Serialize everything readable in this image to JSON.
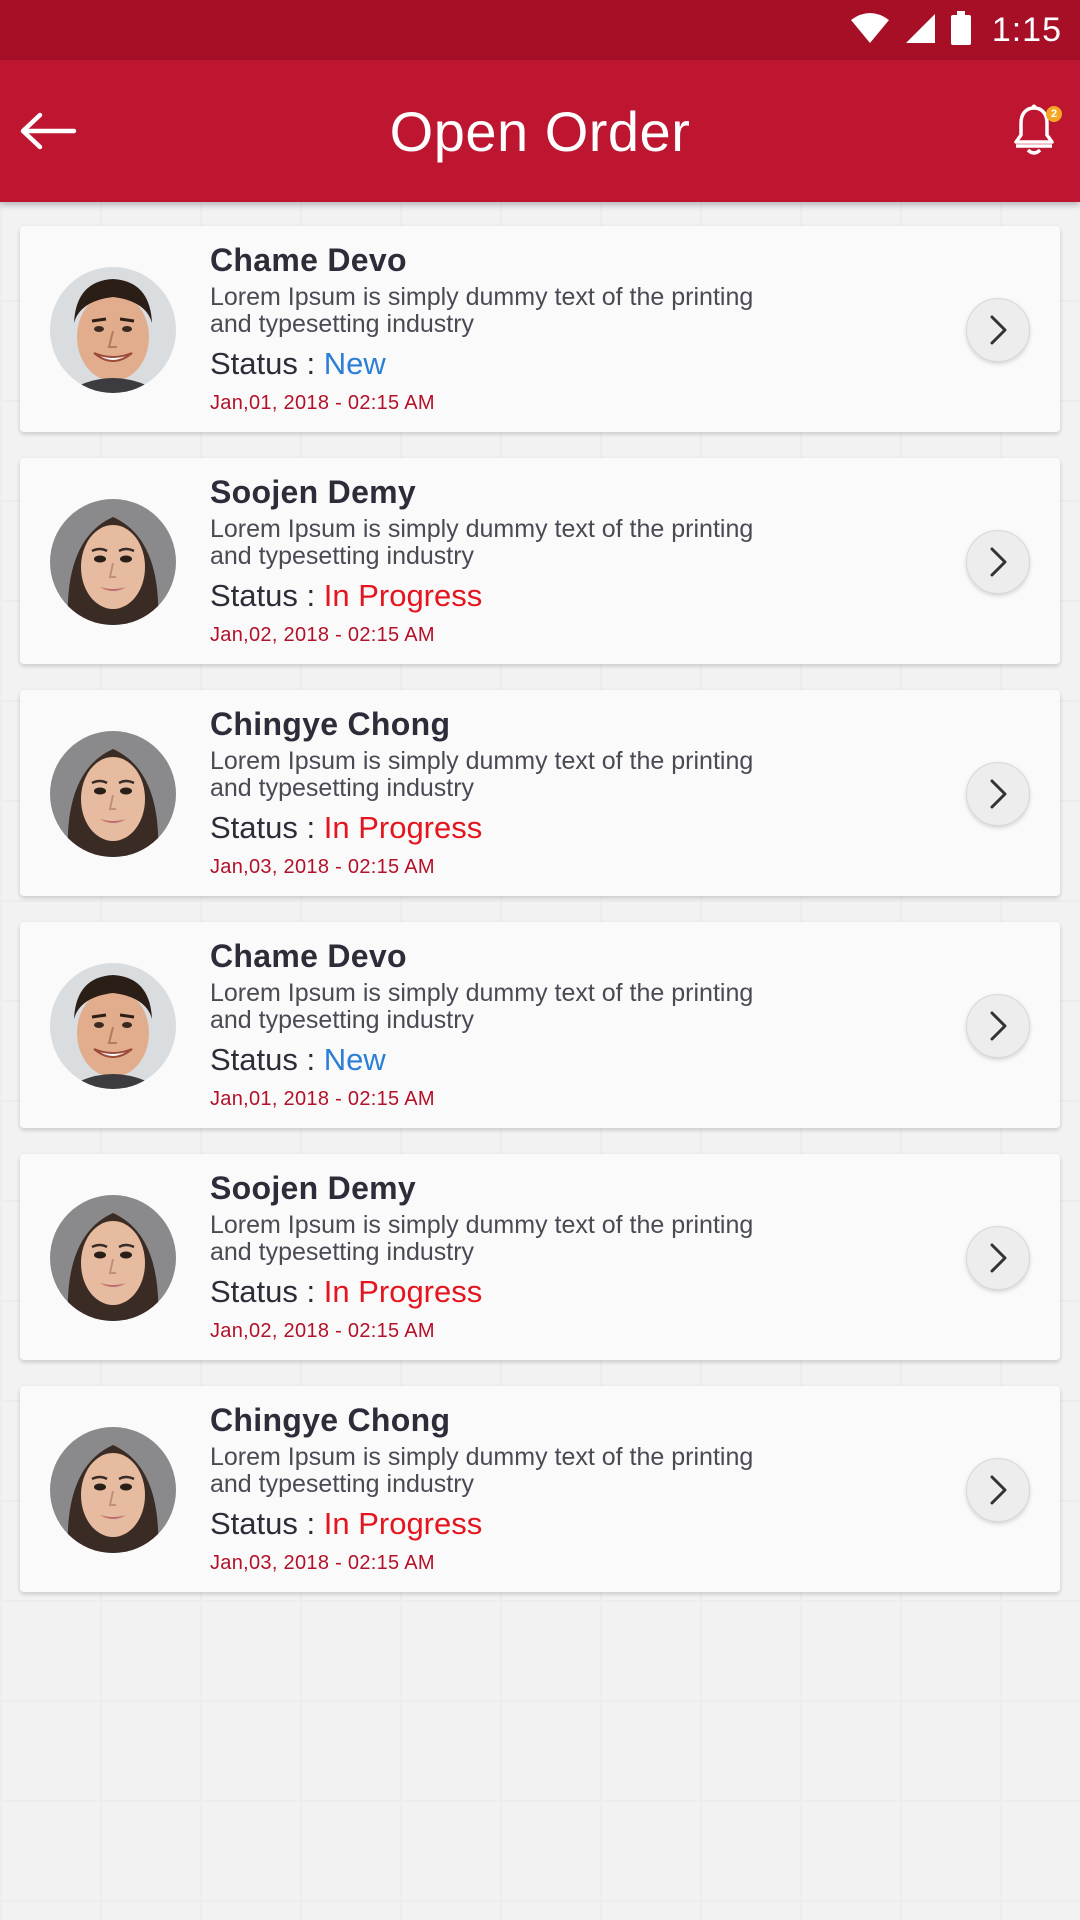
{
  "status_bar": {
    "time": "1:15"
  },
  "header": {
    "title": "Open Order",
    "notification_count": "2"
  },
  "status_prefix": "Status : ",
  "colors": {
    "primary": "#be1530",
    "status_bar": "#a70f27",
    "new": "#2c7fd8",
    "in_progress": "#e4151f",
    "date": "#b3102a"
  },
  "orders": [
    {
      "name": "Chame Devo",
      "desc_line1": "Lorem Ipsum is simply dummy text of the printing",
      "desc_line2": "and typesetting industry",
      "status": "New",
      "date": "Jan,01, 2018 - 02:15 AM",
      "avatar": "male-avatar"
    },
    {
      "name": "Soojen Demy",
      "desc_line1": "Lorem Ipsum is simply dummy text of the printing",
      "desc_line2": "and typesetting industry",
      "status": "In Progress",
      "date": "Jan,02, 2018 - 02:15 AM",
      "avatar": "female-avatar"
    },
    {
      "name": "Chingye Chong",
      "desc_line1": "Lorem Ipsum is simply dummy text of the printing",
      "desc_line2": "and typesetting industry",
      "status": "In Progress",
      "date": "Jan,03, 2018 - 02:15 AM",
      "avatar": "female-avatar"
    },
    {
      "name": "Chame Devo",
      "desc_line1": "Lorem Ipsum is simply dummy text of the printing",
      "desc_line2": "and typesetting industry",
      "status": "New",
      "date": "Jan,01, 2018 - 02:15 AM",
      "avatar": "male-avatar"
    },
    {
      "name": "Soojen Demy",
      "desc_line1": "Lorem Ipsum is simply dummy text of the printing",
      "desc_line2": "and typesetting industry",
      "status": "In Progress",
      "date": "Jan,02, 2018 - 02:15 AM",
      "avatar": "female-avatar"
    },
    {
      "name": "Chingye Chong",
      "desc_line1": "Lorem Ipsum is simply dummy text of the printing",
      "desc_line2": "and typesetting industry",
      "status": "In Progress",
      "date": "Jan,03, 2018 - 02:15 AM",
      "avatar": "female-avatar"
    }
  ]
}
